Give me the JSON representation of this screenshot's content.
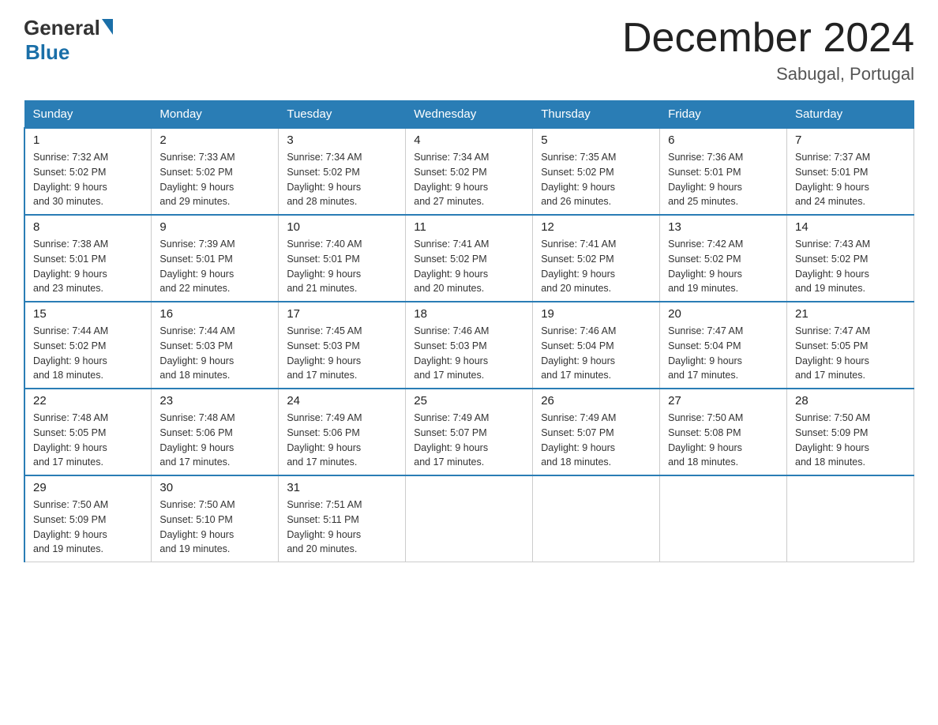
{
  "header": {
    "logo": {
      "general": "General",
      "blue": "Blue"
    },
    "title": "December 2024",
    "location": "Sabugal, Portugal"
  },
  "days_of_week": [
    "Sunday",
    "Monday",
    "Tuesday",
    "Wednesday",
    "Thursday",
    "Friday",
    "Saturday"
  ],
  "weeks": [
    [
      {
        "day": "1",
        "sunrise": "7:32 AM",
        "sunset": "5:02 PM",
        "daylight": "9 hours and 30 minutes."
      },
      {
        "day": "2",
        "sunrise": "7:33 AM",
        "sunset": "5:02 PM",
        "daylight": "9 hours and 29 minutes."
      },
      {
        "day": "3",
        "sunrise": "7:34 AM",
        "sunset": "5:02 PM",
        "daylight": "9 hours and 28 minutes."
      },
      {
        "day": "4",
        "sunrise": "7:34 AM",
        "sunset": "5:02 PM",
        "daylight": "9 hours and 27 minutes."
      },
      {
        "day": "5",
        "sunrise": "7:35 AM",
        "sunset": "5:02 PM",
        "daylight": "9 hours and 26 minutes."
      },
      {
        "day": "6",
        "sunrise": "7:36 AM",
        "sunset": "5:01 PM",
        "daylight": "9 hours and 25 minutes."
      },
      {
        "day": "7",
        "sunrise": "7:37 AM",
        "sunset": "5:01 PM",
        "daylight": "9 hours and 24 minutes."
      }
    ],
    [
      {
        "day": "8",
        "sunrise": "7:38 AM",
        "sunset": "5:01 PM",
        "daylight": "9 hours and 23 minutes."
      },
      {
        "day": "9",
        "sunrise": "7:39 AM",
        "sunset": "5:01 PM",
        "daylight": "9 hours and 22 minutes."
      },
      {
        "day": "10",
        "sunrise": "7:40 AM",
        "sunset": "5:01 PM",
        "daylight": "9 hours and 21 minutes."
      },
      {
        "day": "11",
        "sunrise": "7:41 AM",
        "sunset": "5:02 PM",
        "daylight": "9 hours and 20 minutes."
      },
      {
        "day": "12",
        "sunrise": "7:41 AM",
        "sunset": "5:02 PM",
        "daylight": "9 hours and 20 minutes."
      },
      {
        "day": "13",
        "sunrise": "7:42 AM",
        "sunset": "5:02 PM",
        "daylight": "9 hours and 19 minutes."
      },
      {
        "day": "14",
        "sunrise": "7:43 AM",
        "sunset": "5:02 PM",
        "daylight": "9 hours and 19 minutes."
      }
    ],
    [
      {
        "day": "15",
        "sunrise": "7:44 AM",
        "sunset": "5:02 PM",
        "daylight": "9 hours and 18 minutes."
      },
      {
        "day": "16",
        "sunrise": "7:44 AM",
        "sunset": "5:03 PM",
        "daylight": "9 hours and 18 minutes."
      },
      {
        "day": "17",
        "sunrise": "7:45 AM",
        "sunset": "5:03 PM",
        "daylight": "9 hours and 17 minutes."
      },
      {
        "day": "18",
        "sunrise": "7:46 AM",
        "sunset": "5:03 PM",
        "daylight": "9 hours and 17 minutes."
      },
      {
        "day": "19",
        "sunrise": "7:46 AM",
        "sunset": "5:04 PM",
        "daylight": "9 hours and 17 minutes."
      },
      {
        "day": "20",
        "sunrise": "7:47 AM",
        "sunset": "5:04 PM",
        "daylight": "9 hours and 17 minutes."
      },
      {
        "day": "21",
        "sunrise": "7:47 AM",
        "sunset": "5:05 PM",
        "daylight": "9 hours and 17 minutes."
      }
    ],
    [
      {
        "day": "22",
        "sunrise": "7:48 AM",
        "sunset": "5:05 PM",
        "daylight": "9 hours and 17 minutes."
      },
      {
        "day": "23",
        "sunrise": "7:48 AM",
        "sunset": "5:06 PM",
        "daylight": "9 hours and 17 minutes."
      },
      {
        "day": "24",
        "sunrise": "7:49 AM",
        "sunset": "5:06 PM",
        "daylight": "9 hours and 17 minutes."
      },
      {
        "day": "25",
        "sunrise": "7:49 AM",
        "sunset": "5:07 PM",
        "daylight": "9 hours and 17 minutes."
      },
      {
        "day": "26",
        "sunrise": "7:49 AM",
        "sunset": "5:07 PM",
        "daylight": "9 hours and 18 minutes."
      },
      {
        "day": "27",
        "sunrise": "7:50 AM",
        "sunset": "5:08 PM",
        "daylight": "9 hours and 18 minutes."
      },
      {
        "day": "28",
        "sunrise": "7:50 AM",
        "sunset": "5:09 PM",
        "daylight": "9 hours and 18 minutes."
      }
    ],
    [
      {
        "day": "29",
        "sunrise": "7:50 AM",
        "sunset": "5:09 PM",
        "daylight": "9 hours and 19 minutes."
      },
      {
        "day": "30",
        "sunrise": "7:50 AM",
        "sunset": "5:10 PM",
        "daylight": "9 hours and 19 minutes."
      },
      {
        "day": "31",
        "sunrise": "7:51 AM",
        "sunset": "5:11 PM",
        "daylight": "9 hours and 20 minutes."
      },
      null,
      null,
      null,
      null
    ]
  ],
  "labels": {
    "sunrise": "Sunrise:",
    "sunset": "Sunset:",
    "daylight": "Daylight:"
  }
}
